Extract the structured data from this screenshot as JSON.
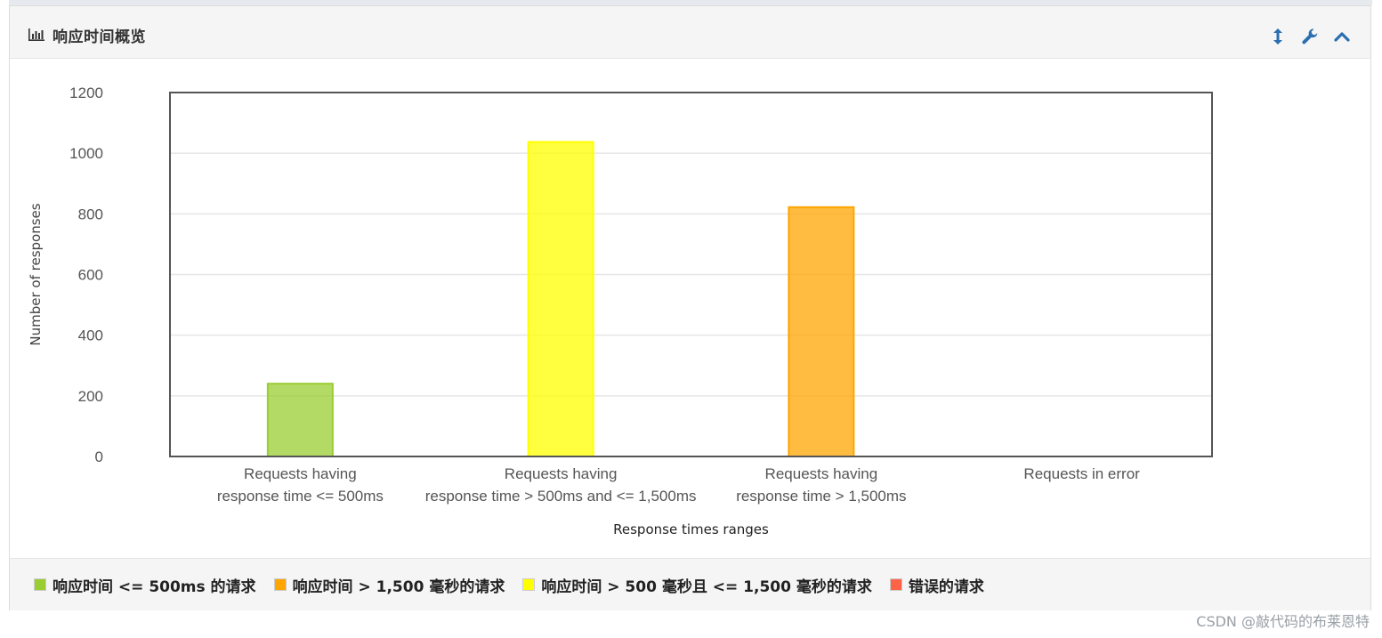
{
  "panel": {
    "title": "响应时间概览"
  },
  "colors": {
    "accent": "#2a6fb0",
    "grid": "#e6e6e6",
    "axis": "#555555"
  },
  "chart_data": {
    "type": "bar",
    "xlabel": "Response times ranges",
    "ylabel": "Number of responses",
    "ylim": [
      0,
      1200
    ],
    "yticks": [
      0,
      200,
      400,
      600,
      800,
      1000,
      1200
    ],
    "grid": true,
    "categories": [
      [
        "Requests having",
        "response time <= 500ms"
      ],
      [
        "Requests having",
        "response time > 500ms and <= 1,500ms"
      ],
      [
        "Requests having",
        "response time > 1,500ms"
      ],
      [
        "Requests in error"
      ]
    ],
    "values": [
      240,
      1037,
      822,
      0
    ],
    "bar_colors": [
      "#9acd32",
      "#ffff00",
      "#ffa500",
      "#ff6347"
    ]
  },
  "legend": {
    "items": [
      {
        "label": "响应时间 <= 500ms 的请求",
        "color": "#9acd32"
      },
      {
        "label": "响应时间 > 1,500 毫秒的请求",
        "color": "#ffa500"
      },
      {
        "label": "响应时间 > 500 毫秒且 <= 1,500 毫秒的请求",
        "color": "#ffff00"
      },
      {
        "label": "错误的请求",
        "color": "#ff6347"
      }
    ]
  },
  "watermark": "CSDN @敲代码的布莱恩特"
}
